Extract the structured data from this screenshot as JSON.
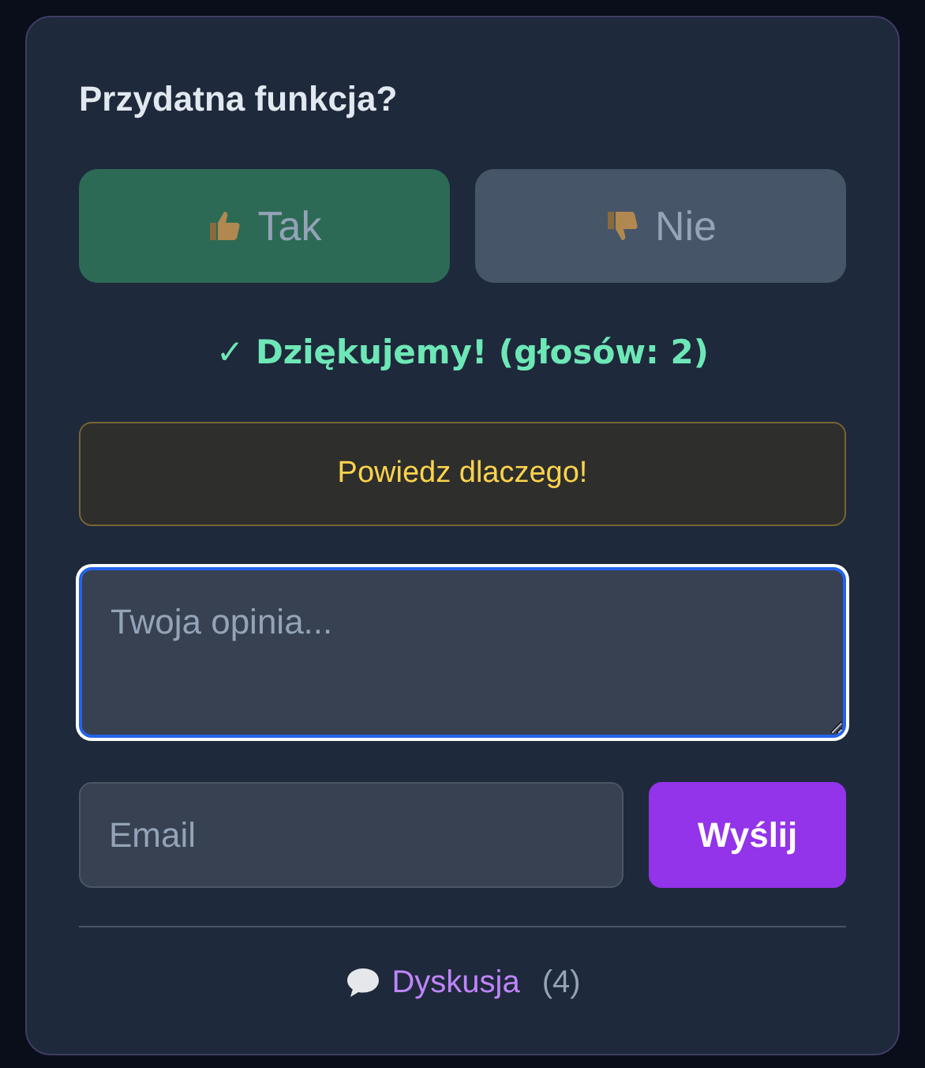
{
  "title": "Przydatna funkcja?",
  "votes": [
    {
      "label": "Tak",
      "kind": "up",
      "selected": true
    },
    {
      "label": "Nie",
      "kind": "down",
      "selected": false
    }
  ],
  "thanks": "✓ Dziękujemy! (głosów: 2)",
  "prompt": "Powiedz dlaczego!",
  "feedback": {
    "placeholder": "Twoja opinia..."
  },
  "email": {
    "placeholder": "Email"
  },
  "submit": "Wyślij",
  "discussion": {
    "label": "Dyskusja",
    "count": "(4)"
  }
}
